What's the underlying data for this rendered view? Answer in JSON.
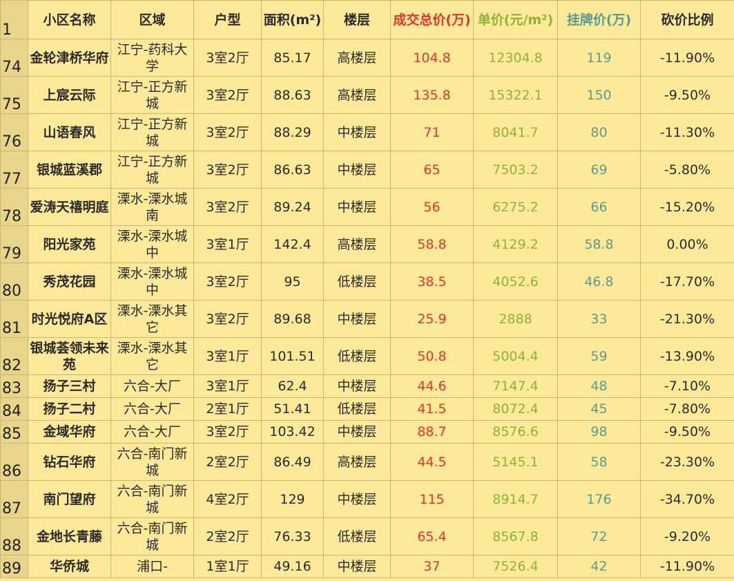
{
  "header": {
    "row_num": "1",
    "name": "小区名称",
    "area": "区域",
    "layout": "户型",
    "size": "面积(m²)",
    "floor": "楼层",
    "total": "成交总价(万)",
    "unit": "单价(元/m²)",
    "listing": "挂牌价(万)",
    "discount": "砍价比例"
  },
  "colors": {
    "background": "#fde99a",
    "rownum_bg": "#e8d58a",
    "total_price": "#e0352b",
    "unit_price": "#8fb13a",
    "listing_price": "#5b9a8e"
  },
  "rows": [
    {
      "num": "74",
      "name": "金轮津桥华府",
      "area": "江宁-药科大学",
      "layout": "3室2厅",
      "size": "85.17",
      "floor": "高楼层",
      "total": "104.8",
      "unit": "12304.8",
      "listing": "119",
      "discount": "-11.90%"
    },
    {
      "num": "75",
      "name": "上宸云际",
      "area": "江宁-正方新城",
      "layout": "3室2厅",
      "size": "88.63",
      "floor": "高楼层",
      "total": "135.8",
      "unit": "15322.1",
      "listing": "150",
      "discount": "-9.50%"
    },
    {
      "num": "76",
      "name": "山语春风",
      "area": "江宁-正方新城",
      "layout": "3室2厅",
      "size": "88.29",
      "floor": "中楼层",
      "total": "71",
      "unit": "8041.7",
      "listing": "80",
      "discount": "-11.30%"
    },
    {
      "num": "77",
      "name": "银城蓝溪郡",
      "area": "江宁-正方新城",
      "layout": "3室2厅",
      "size": "86.63",
      "floor": "中楼层",
      "total": "65",
      "unit": "7503.2",
      "listing": "69",
      "discount": "-5.80%"
    },
    {
      "num": "78",
      "name": "爱涛天禧明庭",
      "area": "溧水-溧水城南",
      "layout": "3室2厅",
      "size": "89.24",
      "floor": "中楼层",
      "total": "56",
      "unit": "6275.2",
      "listing": "66",
      "discount": "-15.20%"
    },
    {
      "num": "79",
      "name": "阳光家苑",
      "area": "溧水-溧水城中",
      "layout": "3室1厅",
      "size": "142.4",
      "floor": "高楼层",
      "total": "58.8",
      "unit": "4129.2",
      "listing": "58.8",
      "discount": "0.00%"
    },
    {
      "num": "80",
      "name": "秀茂花园",
      "area": "溧水-溧水城中",
      "layout": "3室2厅",
      "size": "95",
      "floor": "低楼层",
      "total": "38.5",
      "unit": "4052.6",
      "listing": "46.8",
      "discount": "-17.70%"
    },
    {
      "num": "81",
      "name": "时光悦府A区",
      "area": "溧水-溧水其它",
      "layout": "3室2厅",
      "size": "89.68",
      "floor": "中楼层",
      "total": "25.9",
      "unit": "2888",
      "listing": "33",
      "discount": "-21.30%"
    },
    {
      "num": "82",
      "name": "银城荟领未来苑",
      "area": "溧水-溧水其它",
      "layout": "3室1厅",
      "size": "101.51",
      "floor": "低楼层",
      "total": "50.8",
      "unit": "5004.4",
      "listing": "59",
      "discount": "-13.90%"
    },
    {
      "num": "83",
      "name": "扬子三村",
      "area": "六合-大厂",
      "layout": "3室1厅",
      "size": "62.4",
      "floor": "中楼层",
      "total": "44.6",
      "unit": "7147.4",
      "listing": "48",
      "discount": "-7.10%"
    },
    {
      "num": "84",
      "name": "扬子二村",
      "area": "六合-大厂",
      "layout": "2室1厅",
      "size": "51.41",
      "floor": "低楼层",
      "total": "41.5",
      "unit": "8072.4",
      "listing": "45",
      "discount": "-7.80%"
    },
    {
      "num": "85",
      "name": "金域华府",
      "area": "六合-大厂",
      "layout": "3室2厅",
      "size": "103.42",
      "floor": "中楼层",
      "total": "88.7",
      "unit": "8576.6",
      "listing": "98",
      "discount": "-9.50%"
    },
    {
      "num": "86",
      "name": "钻石华府",
      "area": "六合-南门新城",
      "layout": "2室2厅",
      "size": "86.49",
      "floor": "高楼层",
      "total": "44.5",
      "unit": "5145.1",
      "listing": "58",
      "discount": "-23.30%"
    },
    {
      "num": "87",
      "name": "南门望府",
      "area": "六合-南门新城",
      "layout": "4室2厅",
      "size": "129",
      "floor": "中楼层",
      "total": "115",
      "unit": "8914.7",
      "listing": "176",
      "discount": "-34.70%"
    },
    {
      "num": "88",
      "name": "金地长青藤",
      "area": "六合-南门新城",
      "layout": "2室2厅",
      "size": "76.33",
      "floor": "低楼层",
      "total": "65.4",
      "unit": "8567.8",
      "listing": "72",
      "discount": "-9.20%"
    },
    {
      "num": "89",
      "name": "华侨城",
      "area": "浦口-",
      "layout": "1室1厅",
      "size": "49.16",
      "floor": "中楼层",
      "total": "37",
      "unit": "7526.4",
      "listing": "42",
      "discount": "-11.90%"
    }
  ]
}
